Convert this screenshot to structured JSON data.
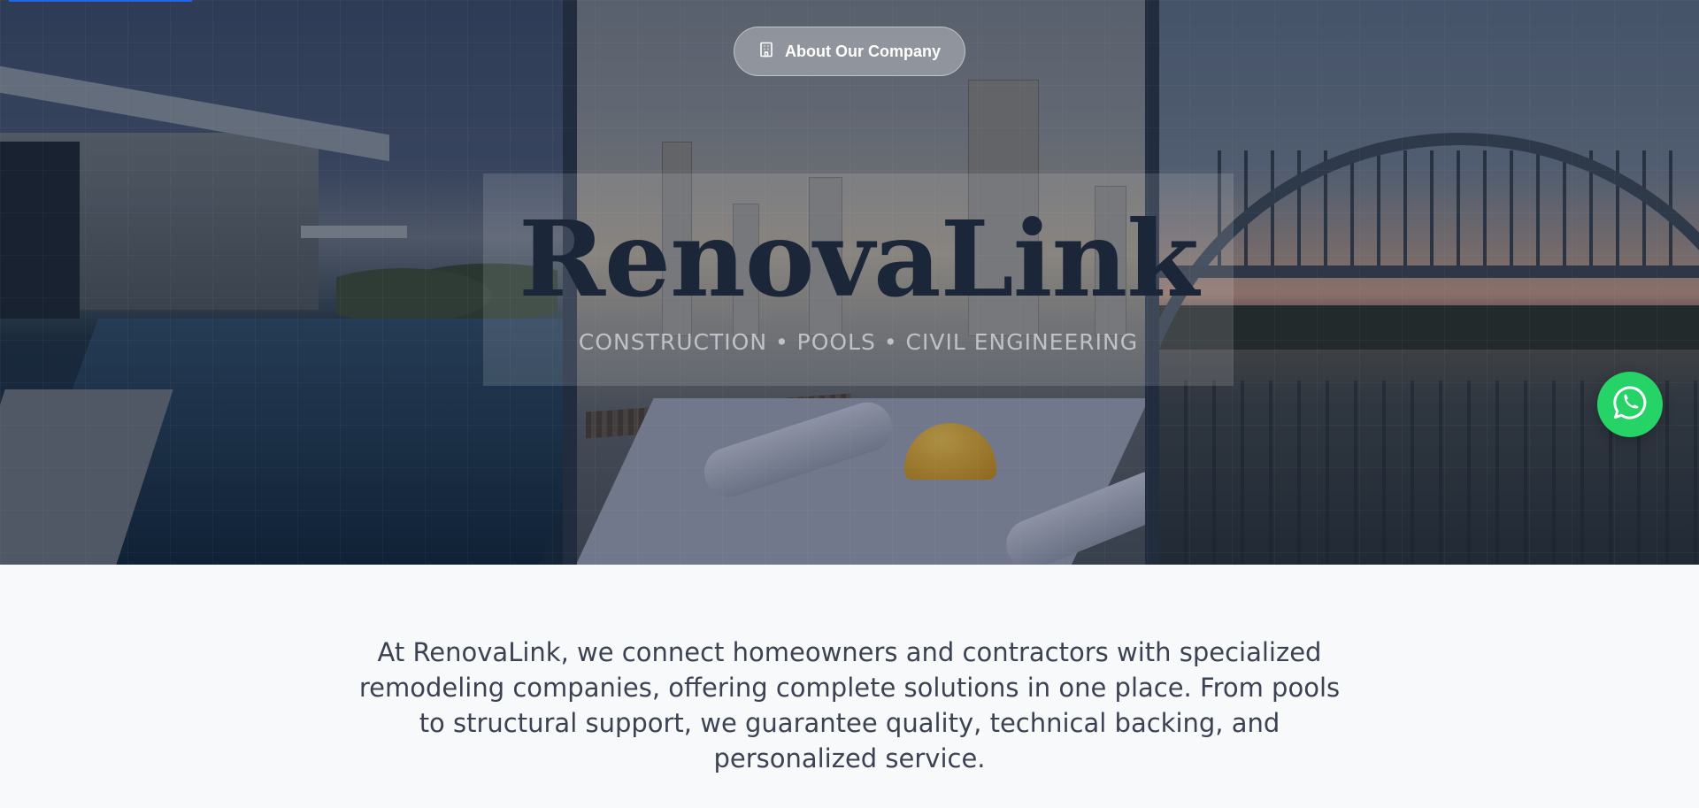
{
  "hero": {
    "about_button_label": "About Our Company",
    "brand_name": "RenovaLink",
    "tagline": "CONSTRUCTION • POOLS • CIVIL ENGINEERING"
  },
  "intro": {
    "text": "At RenovaLink, we connect homeowners and contractors with specialized remodeling companies, offering complete solutions in one place. From pools to structural support, we guarantee quality, technical backing, and personalized service."
  },
  "icons": {
    "about_button": "building-icon",
    "floating_contact": "whatsapp-icon"
  },
  "colors": {
    "accent": "#2563eb",
    "brand_text": "#1b2638",
    "whatsapp": "#25d366",
    "page_background": "#f8f9fb",
    "body_text": "#3b4252"
  }
}
